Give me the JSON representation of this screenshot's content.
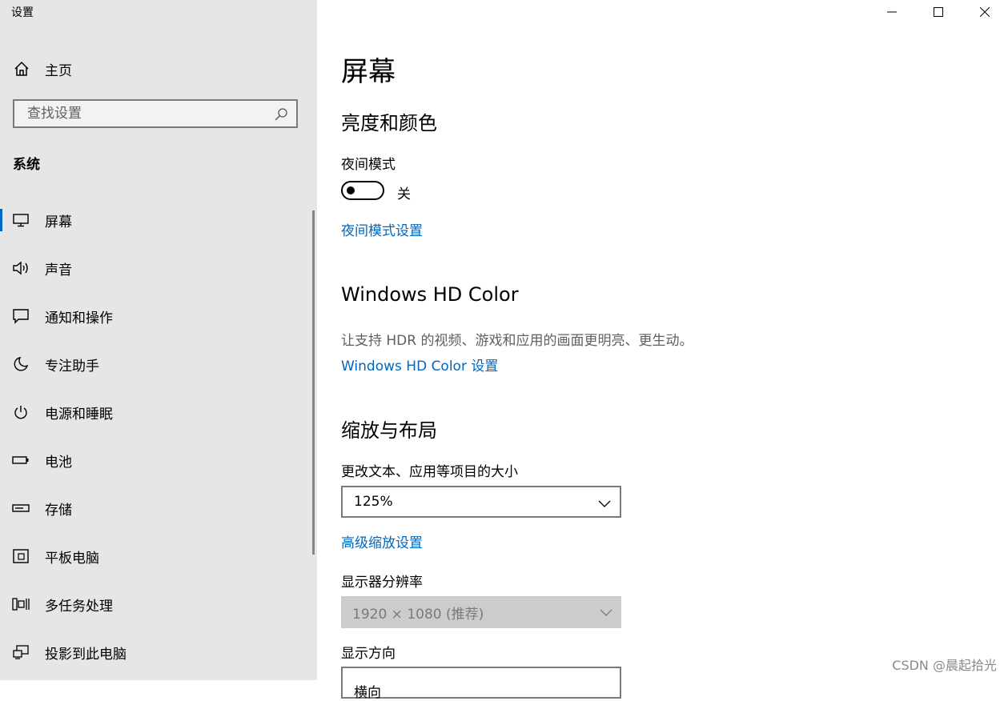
{
  "window": {
    "app_title": "设置"
  },
  "sidebar": {
    "home_label": "主页",
    "search_placeholder": "查找设置",
    "section_label": "系统",
    "items": [
      {
        "label": "屏幕",
        "icon": "monitor-icon",
        "active": true
      },
      {
        "label": "声音",
        "icon": "speaker-icon"
      },
      {
        "label": "通知和操作",
        "icon": "message-icon"
      },
      {
        "label": "专注助手",
        "icon": "moon-icon"
      },
      {
        "label": "电源和睡眠",
        "icon": "power-icon"
      },
      {
        "label": "电池",
        "icon": "battery-icon"
      },
      {
        "label": "存储",
        "icon": "storage-icon"
      },
      {
        "label": "平板电脑",
        "icon": "tablet-icon"
      },
      {
        "label": "多任务处理",
        "icon": "multitask-icon"
      },
      {
        "label": "投影到此电脑",
        "icon": "project-icon"
      }
    ]
  },
  "main": {
    "page_title": "屏幕",
    "brightness_section": "亮度和颜色",
    "night_mode_label": "夜间模式",
    "night_mode_state": "关",
    "night_mode_link": "夜间模式设置",
    "hdr_section": "Windows HD Color",
    "hdr_desc": "让支持 HDR 的视频、游戏和应用的画面更明亮、更生动。",
    "hdr_link": "Windows HD Color 设置",
    "scale_section": "缩放与布局",
    "text_size_label": "更改文本、应用等项目的大小",
    "text_size_value": "125%",
    "advanced_scale_link": "高级缩放设置",
    "resolution_label": "显示器分辨率",
    "resolution_value": "1920 × 1080 (推荐)",
    "orientation_label": "显示方向",
    "orientation_value": "横向"
  },
  "watermark": "CSDN @晨起拾光"
}
